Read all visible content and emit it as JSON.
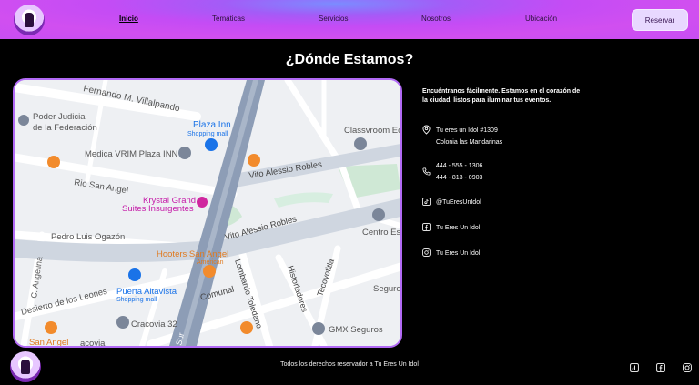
{
  "nav": {
    "items": [
      {
        "label": "Inicio",
        "active": true
      },
      {
        "label": "Temáticas"
      },
      {
        "label": "Servicios"
      },
      {
        "label": "Nosotros"
      },
      {
        "label": "Ubicación"
      }
    ],
    "reserve_label": "Reservar"
  },
  "page": {
    "title": "¿Dónde Estamos?"
  },
  "map": {
    "labels": {
      "fernando": "Fernando M. Villalpando",
      "poder1": "Poder Judicial",
      "poder2": "de la Federación",
      "plaza_inn": "Plaza Inn",
      "shopping_mall": "Shopping mall",
      "classvroom": "Classvroom Ec",
      "medica": "Medica VRIM Plaza INN",
      "rio": "Rio San Angel",
      "vito1": "Vito Alessio Robles",
      "krystal1": "Krystal Grand",
      "krystal2": "Suites Insurgentes",
      "vito2": "Vito Alessio Robles",
      "centro": "Centro Esc",
      "pedro": "Pedro Luis Ogazón",
      "hooters": "Hooters San Angel",
      "american": "American",
      "angelina": "C. Angelina",
      "lombardo": "Lombardo Toledano",
      "historiadores": "Historiadores",
      "tecoyotitla": "Tecoyotitla",
      "desierto": "Desierto de los Leones",
      "puerta1": "Puerta Altavista",
      "puerta2": "Shopping mall",
      "comunal": "Comunal",
      "segur": "Seguro",
      "cracovia": "Cracovia 32",
      "gmx": "GMX Seguros",
      "san_angel": "San Angel",
      "acovia": "acovia",
      "sur": "Sur"
    }
  },
  "contact": {
    "lead": "Encuéntranos fácilmente. Estamos en el corazón de la ciudad, listos para iluminar tus eventos.",
    "address_line1": "Tu eres un Idol #1309",
    "address_line2": "Colonia las Mandarinas",
    "phone1": "444 - 555 - 1306",
    "phone2": "444 - 813 - 0903",
    "tiktok": "@TuEresUnIdol",
    "facebook": "Tu Eres Un Idol",
    "instagram": "Tu Eres Un Idol"
  },
  "footer": {
    "text": "Todos los derechos reservador a Tu Eres Un Idol"
  },
  "colors": {
    "accent": "#b26af5",
    "nav_gradient_start": "#7b8cff",
    "nav_gradient_end": "#d14ff0"
  }
}
